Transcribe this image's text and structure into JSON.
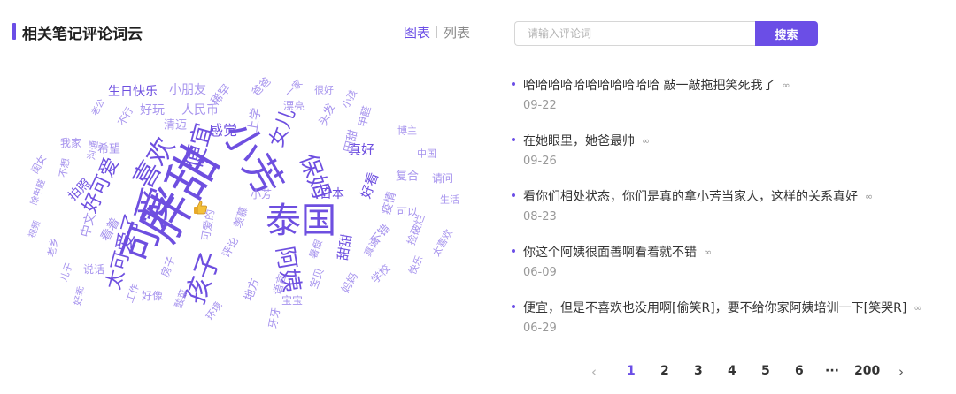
{
  "panel": {
    "title": "相关笔记评论词云",
    "view_chart": "图表",
    "view_list": "列表"
  },
  "search": {
    "placeholder": "请输入评论词",
    "button": "搜索"
  },
  "comments": [
    {
      "text": "哈哈哈哈哈哈哈哈哈哈哈 敲一敲拖把笑死我了",
      "date": "09-22"
    },
    {
      "text": "在她眼里，她爸最帅",
      "date": "09-26"
    },
    {
      "text": "看你们相处状态，你们是真的拿小芳当家人，这样的关系真好",
      "date": "08-23"
    },
    {
      "text": "你这个阿姨很面善啊看着就不错",
      "date": "06-09"
    },
    {
      "text": "便宜，但是不喜欢也没用啊[偷笑R]，要不给你家阿姨培训一下[笑哭R]",
      "date": "06-29"
    }
  ],
  "pagination": {
    "prev": "‹",
    "pages": [
      "1",
      "2",
      "3",
      "4",
      "5",
      "6",
      "···",
      "200"
    ],
    "current": "1",
    "next": "›"
  },
  "colors": {
    "accent": "#6b4ee6",
    "word_dark": "#6e4fe0",
    "word_light": "#a794ee"
  },
  "word_cloud": [
    {
      "t": "胖甜",
      "c": "dark"
    },
    {
      "t": "小芳",
      "c": "dark"
    },
    {
      "t": "泰国",
      "c": "dark"
    },
    {
      "t": "可爱",
      "c": "dark"
    },
    {
      "t": "孩子",
      "c": "dark"
    },
    {
      "t": "喜欢",
      "c": "dark"
    },
    {
      "t": "便宜",
      "c": "dark"
    },
    {
      "t": "保姆",
      "c": "dark"
    },
    {
      "t": "阿姨",
      "c": "dark"
    },
    {
      "t": "好可爱",
      "c": "dark"
    },
    {
      "t": "太可爱了",
      "c": "dark"
    },
    {
      "t": "女儿",
      "c": "dark"
    },
    {
      "t": "感觉",
      "c": "dark"
    },
    {
      "t": "真好",
      "c": "dark"
    },
    {
      "t": "好看",
      "c": "dark"
    },
    {
      "t": "日本",
      "c": "dark"
    },
    {
      "t": "甜甜",
      "c": "dark"
    },
    {
      "t": "拍照",
      "c": "dark"
    },
    {
      "t": "生日快乐",
      "c": "dark"
    },
    {
      "t": "小朋友",
      "c": "light"
    },
    {
      "t": "稀罕",
      "c": "light"
    },
    {
      "t": "爸爸",
      "c": "light"
    },
    {
      "t": "一家",
      "c": "light"
    },
    {
      "t": "很好",
      "c": "light"
    },
    {
      "t": "小孩",
      "c": "light"
    },
    {
      "t": "好玩",
      "c": "light"
    },
    {
      "t": "人民币",
      "c": "light"
    },
    {
      "t": "清迈",
      "c": "light"
    },
    {
      "t": "上学",
      "c": "light"
    },
    {
      "t": "漂亮",
      "c": "light"
    },
    {
      "t": "头发",
      "c": "light"
    },
    {
      "t": "甲醛",
      "c": "light"
    },
    {
      "t": "博主",
      "c": "light"
    },
    {
      "t": "不行",
      "c": "light"
    },
    {
      "t": "老公",
      "c": "light"
    },
    {
      "t": "希望",
      "c": "light"
    },
    {
      "t": "我家",
      "c": "light"
    },
    {
      "t": "沟通",
      "c": "light"
    },
    {
      "t": "田甜",
      "c": "light"
    },
    {
      "t": "中国",
      "c": "light"
    },
    {
      "t": "闺女",
      "c": "light"
    },
    {
      "t": "不想",
      "c": "light"
    },
    {
      "t": "复合",
      "c": "light"
    },
    {
      "t": "请问",
      "c": "light"
    },
    {
      "t": "除甲醛",
      "c": "light"
    },
    {
      "t": "疫情",
      "c": "light"
    },
    {
      "t": "生活",
      "c": "light"
    },
    {
      "t": "中文",
      "c": "light"
    },
    {
      "t": "视频",
      "c": "light"
    },
    {
      "t": "老乡",
      "c": "light"
    },
    {
      "t": "看着",
      "c": "light"
    },
    {
      "t": "不错",
      "c": "light"
    },
    {
      "t": "捡破烂",
      "c": "light"
    },
    {
      "t": "太喜欢",
      "c": "light"
    },
    {
      "t": "可爱的",
      "c": "light"
    },
    {
      "t": "说话",
      "c": "light"
    },
    {
      "t": "房子",
      "c": "light"
    },
    {
      "t": "好像",
      "c": "light"
    },
    {
      "t": "工作",
      "c": "light"
    },
    {
      "t": "环境",
      "c": "light"
    },
    {
      "t": "地方",
      "c": "light"
    },
    {
      "t": "语言",
      "c": "light"
    },
    {
      "t": "宝宝",
      "c": "light"
    },
    {
      "t": "宝贝",
      "c": "light"
    },
    {
      "t": "妈妈",
      "c": "light"
    },
    {
      "t": "学校",
      "c": "light"
    },
    {
      "t": "牙牙",
      "c": "light"
    },
    {
      "t": "酸菜",
      "c": "light"
    },
    {
      "t": "好乖",
      "c": "light"
    },
    {
      "t": "儿子",
      "c": "light"
    },
    {
      "t": "快乐",
      "c": "light"
    },
    {
      "t": "羡慕",
      "c": "light"
    },
    {
      "t": "暑假",
      "c": "light"
    },
    {
      "t": "评论",
      "c": "light"
    },
    {
      "t": "可以",
      "c": "light"
    },
    {
      "t": "小芳",
      "c": "light"
    },
    {
      "t": "真诚",
      "c": "light"
    },
    {
      "t": "喜欢",
      "c": "light"
    }
  ]
}
